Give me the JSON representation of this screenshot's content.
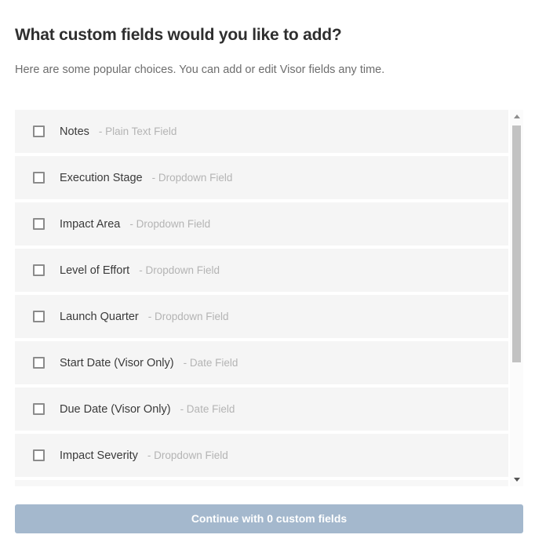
{
  "header": {
    "title": "What custom fields would you like to add?",
    "subtitle": "Here are some popular choices. You can add or edit Visor fields any time."
  },
  "field_list": {
    "items": [
      {
        "label": "Notes",
        "type": "- Plain Text Field",
        "checked": false
      },
      {
        "label": "Execution Stage",
        "type": "- Dropdown Field",
        "checked": false
      },
      {
        "label": "Impact Area",
        "type": "- Dropdown Field",
        "checked": false
      },
      {
        "label": "Level of Effort",
        "type": "- Dropdown Field",
        "checked": false
      },
      {
        "label": "Launch Quarter",
        "type": "- Dropdown Field",
        "checked": false
      },
      {
        "label": "Start Date (Visor Only)",
        "type": "- Date Field",
        "checked": false
      },
      {
        "label": "Due Date (Visor Only)",
        "type": "- Date Field",
        "checked": false
      },
      {
        "label": "Impact Severity",
        "type": "- Dropdown Field",
        "checked": false
      }
    ]
  },
  "scrollbar": {
    "up_arrow_icon": "chevron-up-icon",
    "down_arrow_icon": "chevron-down-icon",
    "thumb_color": "#c2c2c2"
  },
  "footer": {
    "continue_label": "Continue with 0 custom fields",
    "selected_count": 0,
    "button_color": "#a4b8cd"
  }
}
